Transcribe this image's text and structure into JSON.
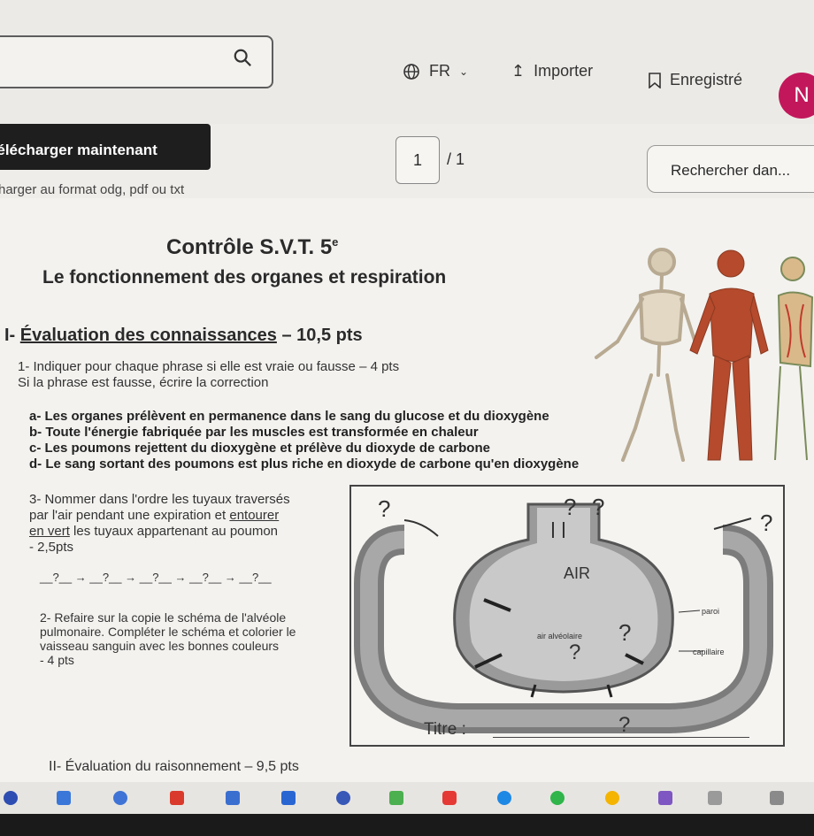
{
  "topbar": {
    "language": "FR",
    "import_label": "Importer",
    "saved_label": "Enregistré",
    "avatar_initial": "N",
    "download_label": "Télécharger maintenant",
    "download_hint": "harger au format odg, pdf ou txt",
    "page_current": "1",
    "page_total": "/ 1",
    "search_placeholder": "Rechercher dan..."
  },
  "doc": {
    "title": "Contrôle S.V.T. 5",
    "title_sup": "e",
    "subtitle": "Le fonctionnement des organes et respiration",
    "section1_prefix": "I- ",
    "section1_title": "Évaluation des connaissances",
    "section1_points": " – 10,5 pts",
    "q1_line1": "1- Indiquer pour chaque phrase si elle est vraie ou fausse – 4 pts",
    "q1_line2": "Si la phrase est fausse, écrire la correction",
    "q1_a": "a- Les organes prélèvent en permanence dans le sang du glucose et du dioxygène",
    "q1_b": "b- Toute l'énergie fabriquée par les muscles est transformée en chaleur",
    "q1_c": "c- Les poumons rejettent du dioxygène et prélève du dioxyde de carbone",
    "q1_d": "d- Le sang sortant des poumons est plus riche en dioxyde de carbone qu'en dioxygène",
    "q3_line1": "3- Nommer dans l'ordre les tuyaux traversés",
    "q3_line2_a": "par l'air pendant une expiration et ",
    "q3_line2_b": "entourer",
    "q3_line3_a": "en vert",
    "q3_line3_b": " les tuyaux appartenant au poumon",
    "q3_line4": "- 2,5pts",
    "q3_chain": "__?__ →  __?__ →  __?__ →  __?__ → __?__",
    "q2_line1": "2- Refaire sur la copie le schéma de l'alvéole",
    "q2_line2": "pulmonaire. Compléter le schéma et colorier le",
    "q2_line3": "vaisseau sanguin avec les bonnes couleurs",
    "q2_line4": "- 4 pts",
    "section2": "II- Évaluation du raisonnement – 9,5 pts"
  },
  "diagram": {
    "q": "?",
    "air": "AIR",
    "paroi": "paroi",
    "air_alveolaire": "air alvéolaire",
    "capillaire": "capillaire",
    "titre": "Titre :"
  },
  "colors": {
    "avatar": "#c2185b",
    "download_button": "#1e1e1e",
    "vessel": "#8a8a8a",
    "alveolus": "#9c9c9c"
  }
}
